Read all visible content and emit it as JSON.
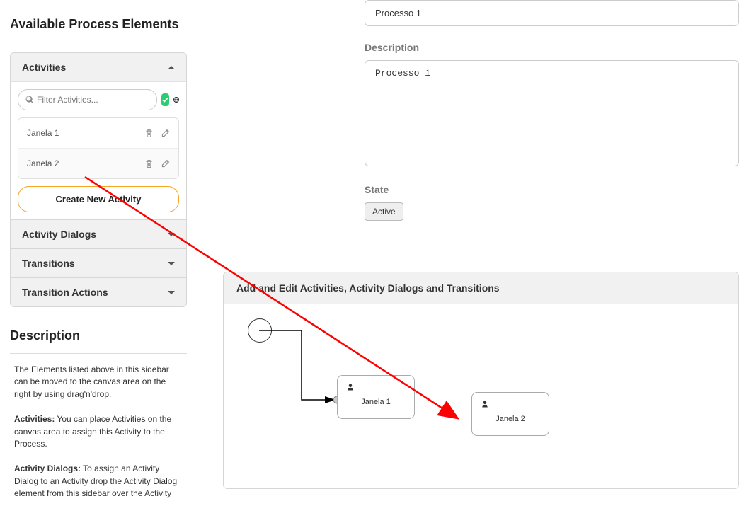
{
  "sidebar": {
    "title": "Available Process Elements",
    "sections": {
      "activities": {
        "label": "Activities",
        "filter_placeholder": "Filter Activities...",
        "items": [
          {
            "label": "Janela 1"
          },
          {
            "label": "Janela 2"
          }
        ],
        "create_label": "Create New Activity"
      },
      "activity_dialogs": {
        "label": "Activity Dialogs"
      },
      "transitions": {
        "label": "Transitions"
      },
      "transition_actions": {
        "label": "Transition Actions"
      }
    },
    "description": {
      "heading": "Description",
      "p1": "The Elements listed above in this sidebar can be moved to the canvas area on the right by using drag'n'drop.",
      "p2_b": "Activities:",
      "p2": " You can place Activities on the canvas area to assign this Activity to the Process.",
      "p3_b": "Activity Dialogs:",
      "p3": " To assign an Activity Dialog to an Activity drop the Activity Dialog element from this sidebar over the Activity"
    }
  },
  "form": {
    "name_value": "Processo 1",
    "description_label": "Description",
    "description_value": "Processo 1",
    "state_label": "State",
    "state_value": "Active"
  },
  "panel": {
    "header": "Add and Edit Activities, Activity Dialogs and Transitions",
    "nodes": [
      {
        "label": "Janela 1"
      },
      {
        "label": "Janela 2"
      }
    ]
  }
}
